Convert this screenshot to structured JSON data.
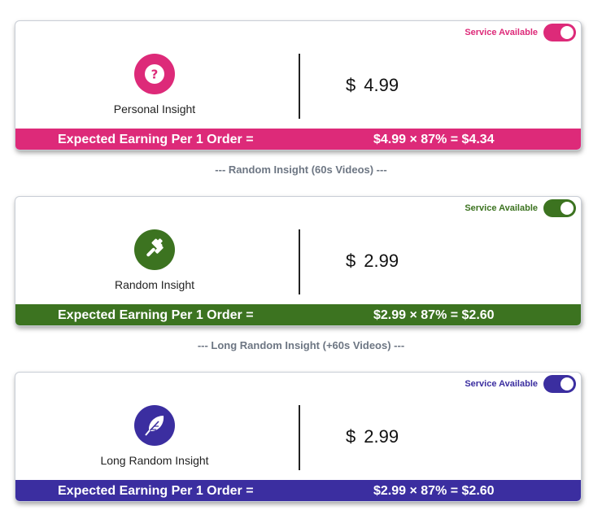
{
  "cards": [
    {
      "service_label": "Service Available",
      "name": "Personal Insight",
      "currency": "$",
      "price": "4.99",
      "earning_label": "Expected Earning Per 1 Order =",
      "earning_formula": "$4.99 × 87% = $4.34",
      "icon": "question-mark-icon",
      "color": "#dd2a79"
    },
    {
      "service_label": "Service Available",
      "name": "Random Insight",
      "currency": "$",
      "price": "2.99",
      "earning_label": "Expected Earning Per 1 Order =",
      "earning_formula": "$2.99 × 87% = $2.60",
      "icon": "gavel-icon",
      "color": "#3c7320"
    },
    {
      "service_label": "Service Available",
      "name": "Long Random Insight",
      "currency": "$",
      "price": "2.99",
      "earning_label": "Expected Earning Per 1 Order =",
      "earning_formula": "$2.99 × 87% = $2.60",
      "icon": "feather-icon",
      "color": "#3b2ea0"
    }
  ],
  "separators": [
    "--- Random Insight (60s Videos) ---",
    "--- Long Random Insight (+60s Videos) ---"
  ]
}
